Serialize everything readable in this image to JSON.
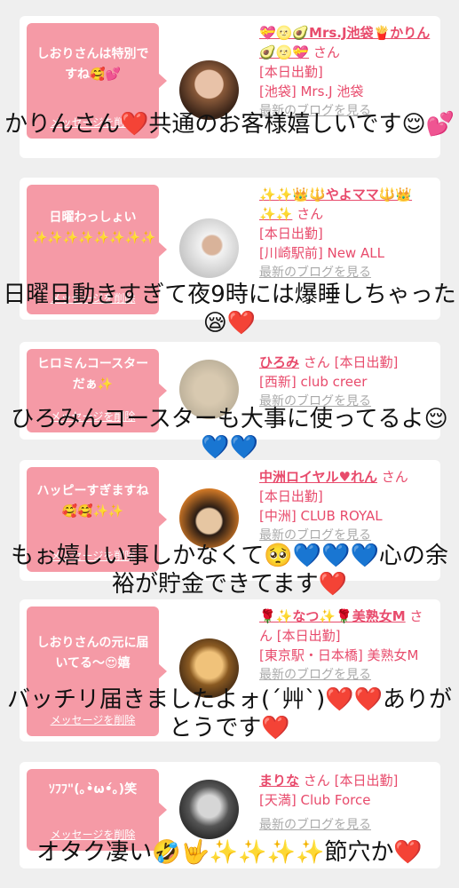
{
  "delete_label": "メッセージを削除",
  "blog_label": "最新のブログを見る",
  "san": "さん",
  "cards": [
    {
      "message": "しおりさんは特別ですね🥰💕",
      "name": "💝🌝🥑Mrs.J池袋🍟かりん🥑🌝💝",
      "status": "[本日出勤]",
      "location": "[池袋] Mrs.J 池袋",
      "caption": "かりんさん❤️共通のお客様嬉しいです😌💕"
    },
    {
      "message": "日曜わっしょい✨✨✨✨✨✨✨✨",
      "name": "✨✨👑🔱やよママ🔱👑✨✨",
      "status": "[本日出勤]",
      "location": "[川崎駅前] New ALL",
      "caption": "日曜日動きすぎて夜9時には爆睡しちゃった😪❤️"
    },
    {
      "message": "ヒロミんコースターだぁ✨",
      "name": "ひろみ",
      "status": "[本日出勤]",
      "location": "[西新] club creer",
      "caption": "ひろみんコースターも大事に使ってるよ😌💙💙"
    },
    {
      "message": "ハッピーすぎますね🥰🥰✨✨",
      "name": "中洲ロイヤル♥れん",
      "status": "[本日出勤]",
      "location": "[中洲] CLUB ROYAL",
      "caption": "もぉ嬉しい事しかなくて🥺💙💙💙心の余裕が貯金できてます❤️"
    },
    {
      "message": "しおりさんの元に届いてる〜😍嬉",
      "name": "🌹✨なつ✨🌹美熟女M",
      "status": "[本日出勤]",
      "location": "[東京駅・日本橋] 美熟女M",
      "caption": "バッチリ届きましたよォ(´艸`)❤️❤️ありがとうです❤️"
    },
    {
      "message": "ｿﾌﾌ\"(｡•̀ω•́｡)笑",
      "name": "まりな",
      "status": "[本日出勤]",
      "location": "[天満] Club Force",
      "caption": "オタク凄い🤣🤟✨✨✨✨節穴か❤️"
    }
  ]
}
